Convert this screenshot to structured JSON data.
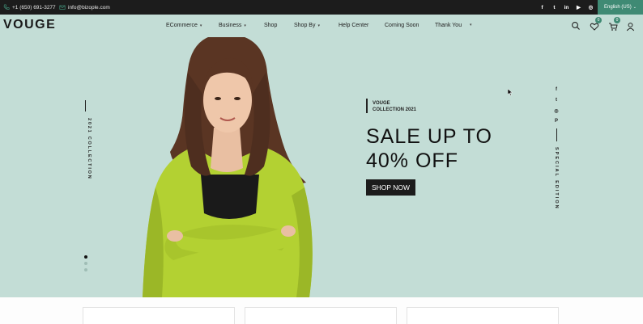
{
  "topbar": {
    "phone": "+1 (650) 691-3277",
    "email": "info@bizople.com",
    "socials": [
      "facebook-icon",
      "twitter-icon",
      "linkedin-icon",
      "youtube-icon",
      "instagram-icon"
    ],
    "language": "English (US)"
  },
  "header": {
    "logo": "VOUGE",
    "nav": [
      {
        "label": "ECommerce",
        "caret": true
      },
      {
        "label": "Business",
        "caret": true
      },
      {
        "label": "Shop",
        "caret": false
      },
      {
        "label": "Shop By",
        "caret": true
      },
      {
        "label": "Help Center",
        "caret": false
      },
      {
        "label": "Coming Soon",
        "caret": false
      },
      {
        "label": "Thank You",
        "caret": false
      }
    ],
    "wishlist_count": "0",
    "cart_count": "0"
  },
  "hero": {
    "side_left_text": "2021 COLLECTION",
    "tag_line1": "VOUGE",
    "tag_line2": "COLLECTION 2021",
    "headline_line1": "SALE UP TO",
    "headline_line2": "40% OFF",
    "button_label": "SHOP NOW",
    "side_right_text": "SPECIAL EDITION",
    "side_socials": [
      "facebook-icon",
      "twitter-icon",
      "instagram-icon",
      "pinterest-icon"
    ],
    "slides_total": 3,
    "active_slide": 1
  },
  "colors": {
    "topbar_bg": "#1c1c1c",
    "accent": "#3f8a74",
    "hero_bg": "#c3ddd6",
    "jacket": "#b3d132"
  }
}
